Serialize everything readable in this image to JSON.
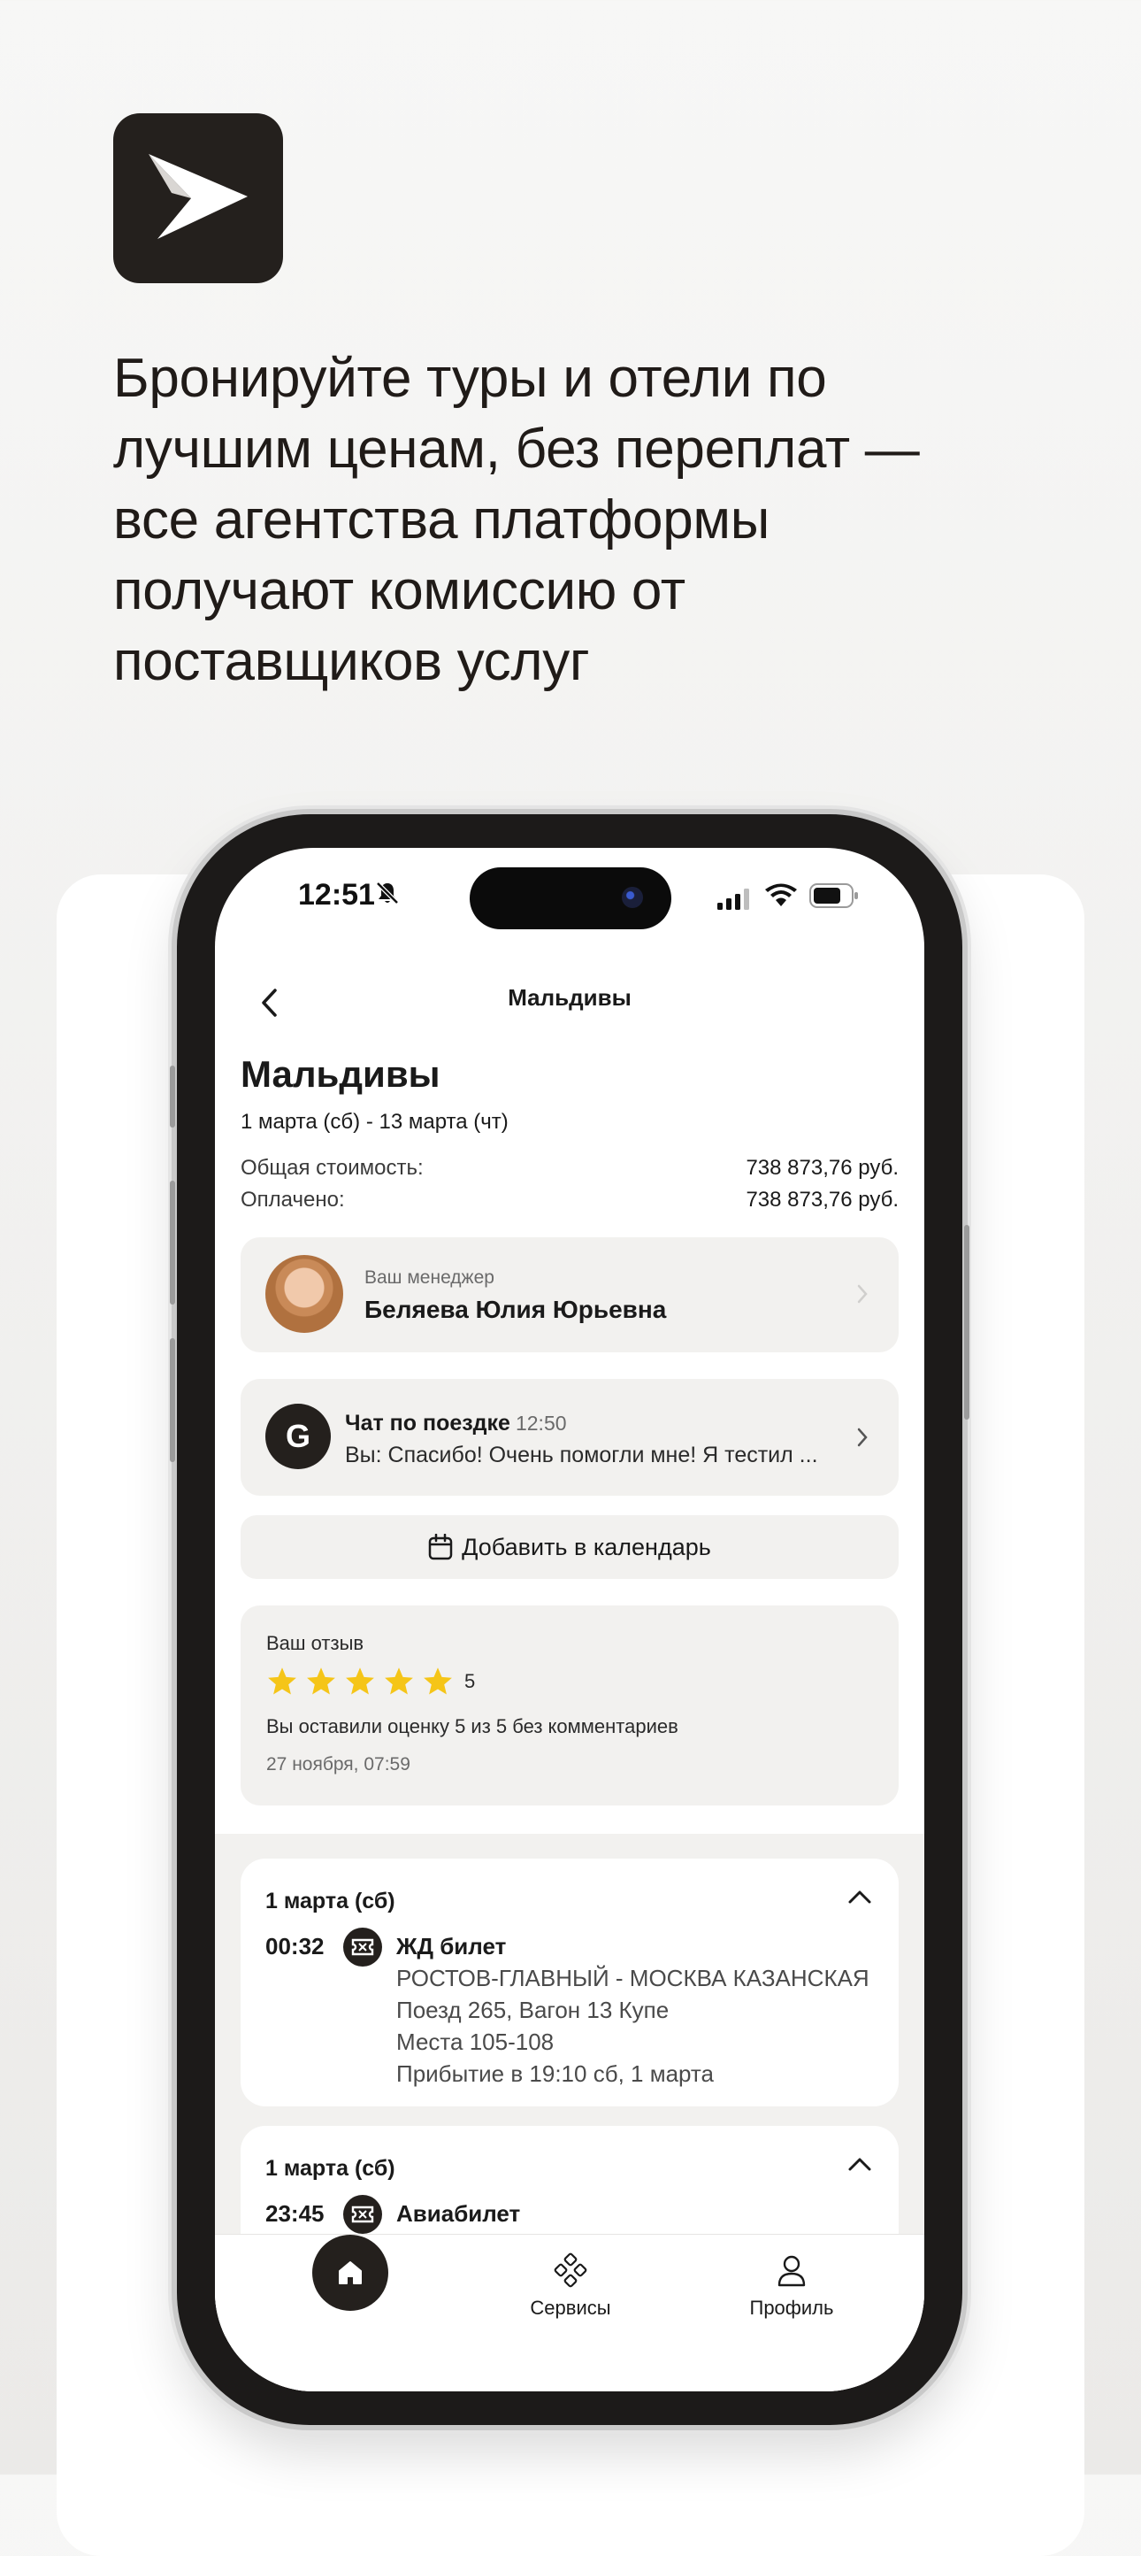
{
  "promo": {
    "headline_lines": [
      "Бронируйте туры и отели по",
      "лучшим ценам, без переплат —",
      "все агентства платформы",
      "получают комиссию от",
      "поставщиков услуг"
    ]
  },
  "status_bar": {
    "time": "12:51"
  },
  "header": {
    "title": "Мальдивы"
  },
  "trip": {
    "title": "Мальдивы",
    "dates": "1 марта (сб) - 13 марта (чт)",
    "total_label": "Общая стоимость:",
    "total_value": "738 873,76  руб.",
    "paid_label": "Оплачено:",
    "paid_value": "738 873,76  руб."
  },
  "manager": {
    "caption": "Ваш менеджер",
    "name": "Беляева Юлия Юрьевна"
  },
  "chat": {
    "avatar_letter": "G",
    "title": "Чат по поездке",
    "time": "12:50",
    "preview": "Вы: Спасибо! Очень помогли мне! Я тестил ..."
  },
  "calendar": {
    "label": "Добавить в календарь"
  },
  "review": {
    "caption": "Ваш отзыв",
    "rating": 5,
    "max_rating": 5,
    "rating_text": "5",
    "text": "Вы оставили оценку 5 из 5 без комментариев",
    "date": "27 ноября, 07:59"
  },
  "itinerary": {
    "days": [
      {
        "title": "1 марта (сб)",
        "segments": [
          {
            "time": "00:32",
            "icon": "ticket-icon",
            "title": "ЖД билет",
            "lines": [
              "РОСТОВ-ГЛАВНЫЙ - МОСКВА КАЗАНСКАЯ",
              "Поезд 265, Вагон 13 Купе",
              "Места 105-108",
              "Прибытие в 19:10 сб, 1 марта"
            ]
          }
        ]
      },
      {
        "title": "1 марта (сб)",
        "segments": [
          {
            "time": "23:45",
            "icon": "ticket-icon",
            "title": "Авиабилет",
            "lines": []
          }
        ]
      }
    ]
  },
  "tab_bar": {
    "home_icon": "home-icon",
    "services_label": "Сервисы",
    "services_icon": "services-icon",
    "profile_label": "Профиль",
    "profile_icon": "user-icon"
  },
  "colors": {
    "brand_dark": "#24201d",
    "card_bg": "#f2f1ef",
    "star": "#f5c518"
  }
}
